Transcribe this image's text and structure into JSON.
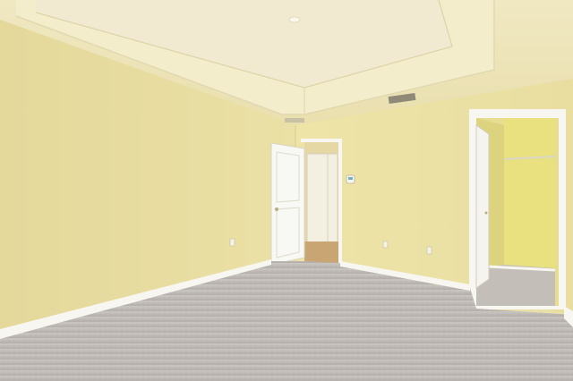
{
  "scene": {
    "description_hidden": "",
    "colors": {
      "wall_left": "#e8dca0",
      "wall_right": "#ece2a6",
      "ceiling": "#efe6bb",
      "tray": "#f3ecc9",
      "carpet": "#bdb8b3",
      "baseboard": "#f7f6f0",
      "door": "#f8f8f4",
      "hallway": "#e6d7a2",
      "closet_wall": "#e8df8e",
      "floor_wood": "#c8a573"
    },
    "icons": [
      "hvac-vent-icon",
      "smoke-detector-icon",
      "thermostat-icon",
      "outlet-icon",
      "door-knob-icon"
    ]
  }
}
